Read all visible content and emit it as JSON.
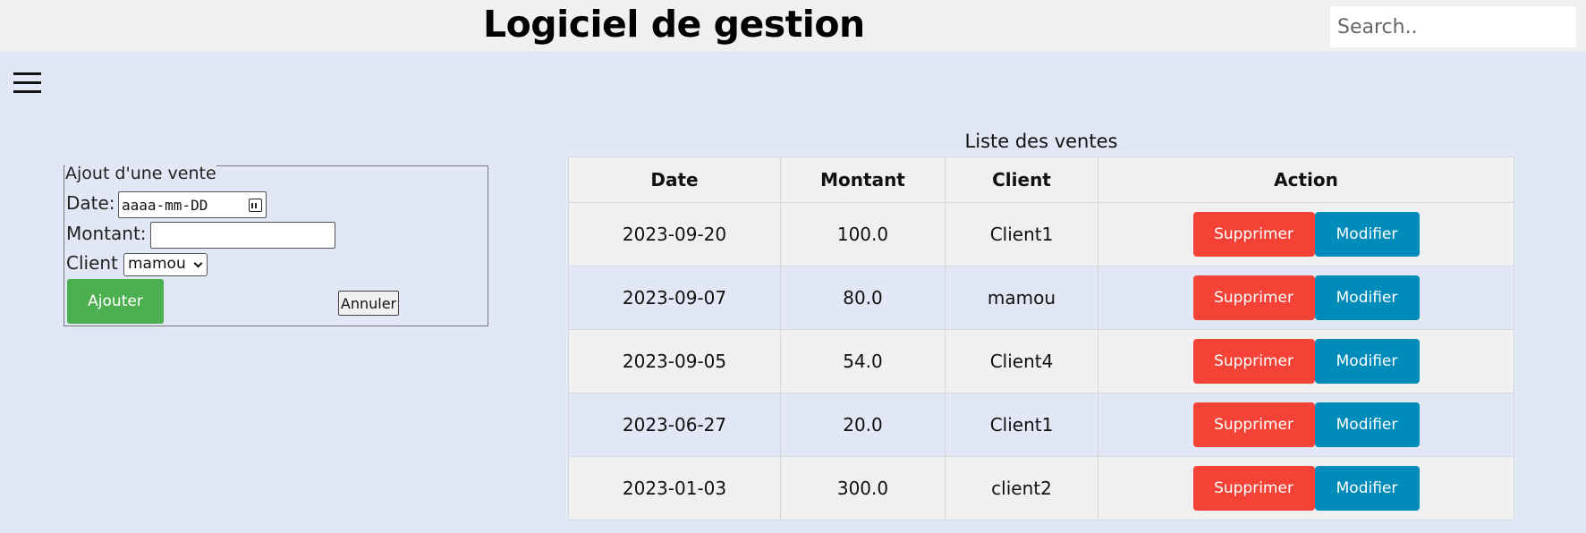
{
  "header": {
    "title": "Logiciel de gestion",
    "search_placeholder": "Search.."
  },
  "icons": {
    "menu": "hamburger-menu-icon",
    "calendar": "calendar-icon",
    "dropdown": "chevron-down-icon"
  },
  "form": {
    "legend": "Ajout d'une vente",
    "date_label": "Date:",
    "date_value": "aaaa-mm-DD",
    "montant_label": "Montant:",
    "montant_value": "",
    "client_label": "Client",
    "client_selected": "mamou",
    "submit_label": "Ajouter",
    "cancel_label": "Annuler"
  },
  "table": {
    "caption": "Liste des ventes",
    "columns": [
      "Date",
      "Montant",
      "Client",
      "Action"
    ],
    "rows": [
      {
        "date": "2023-09-20",
        "montant": "100.0",
        "client": "Client1"
      },
      {
        "date": "2023-09-07",
        "montant": "80.0",
        "client": "mamou"
      },
      {
        "date": "2023-09-05",
        "montant": "54.0",
        "client": "Client4"
      },
      {
        "date": "2023-06-27",
        "montant": "20.0",
        "client": "Client1"
      },
      {
        "date": "2023-01-03",
        "montant": "300.0",
        "client": "client2"
      }
    ],
    "delete_label": "Supprimer",
    "edit_label": "Modifier"
  },
  "colors": {
    "background": "#e2e7f5",
    "header_bg": "#f0f0f0",
    "add_button": "#4caf50",
    "delete_button": "#f44336",
    "edit_button": "#008cba"
  }
}
